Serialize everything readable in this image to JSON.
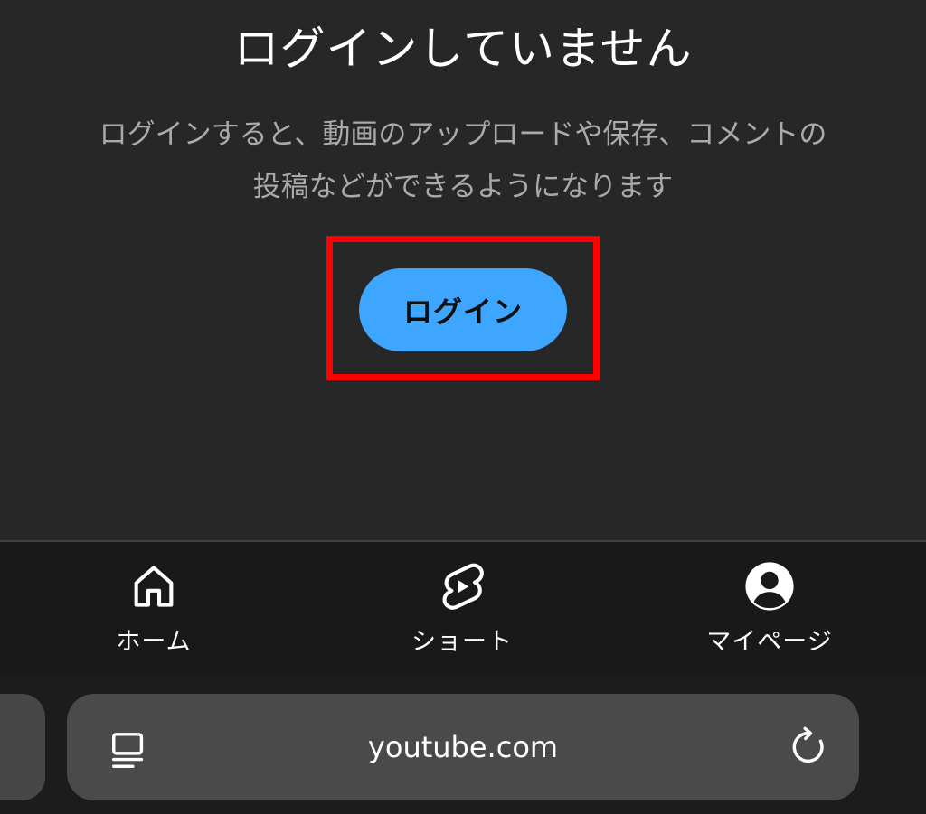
{
  "main": {
    "title": "ログインしていません",
    "description_line1": "ログインすると、動画のアップロードや保存、コメントの",
    "description_line2": "投稿などができるようになります",
    "login_label": "ログイン",
    "highlight_color": "#ff0000",
    "button_color": "#3ea6ff"
  },
  "nav": {
    "items": [
      {
        "label": "ホーム",
        "icon": "home-icon"
      },
      {
        "label": "ショート",
        "icon": "shorts-icon"
      },
      {
        "label": "マイページ",
        "icon": "account-icon"
      }
    ]
  },
  "browser": {
    "url": "youtube.com",
    "left_icon": "reader-icon",
    "right_icon": "reload-icon"
  }
}
